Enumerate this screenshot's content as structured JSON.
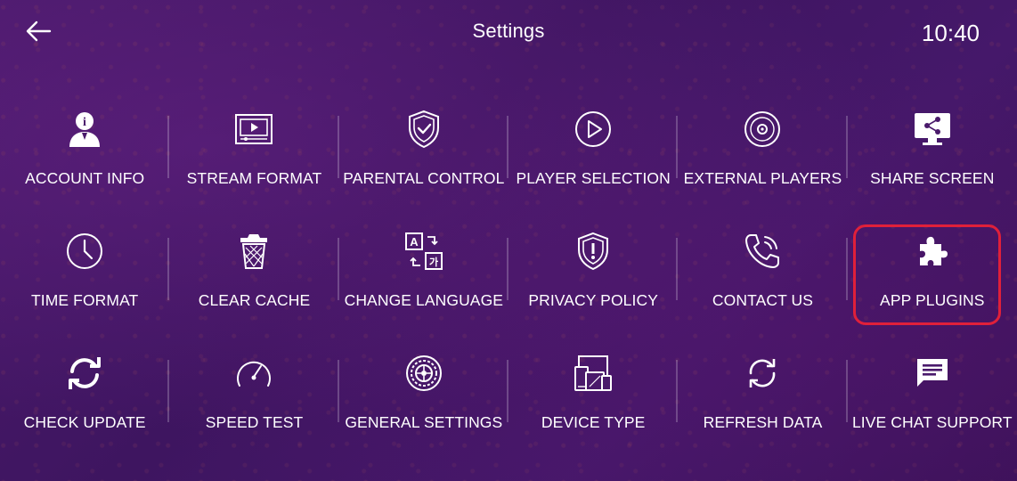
{
  "header": {
    "title": "Settings",
    "time": "10:40"
  },
  "highlight_color": "#e0203a",
  "items": [
    {
      "label": "ACCOUNT INFO",
      "icon": "account-info-icon"
    },
    {
      "label": "STREAM FORMAT",
      "icon": "stream-format-icon"
    },
    {
      "label": "PARENTAL CONTROL",
      "icon": "parental-control-icon"
    },
    {
      "label": "PLAYER SELECTION",
      "icon": "player-selection-icon"
    },
    {
      "label": "EXTERNAL PLAYERS",
      "icon": "external-players-icon"
    },
    {
      "label": "SHARE SCREEN",
      "icon": "share-screen-icon"
    },
    {
      "label": "TIME FORMAT",
      "icon": "clock-icon"
    },
    {
      "label": "CLEAR CACHE",
      "icon": "trash-icon"
    },
    {
      "label": "CHANGE LANGUAGE",
      "icon": "translate-icon"
    },
    {
      "label": "PRIVACY POLICY",
      "icon": "shield-alert-icon"
    },
    {
      "label": "CONTACT US",
      "icon": "phone-icon"
    },
    {
      "label": "APP PLUGINS",
      "icon": "puzzle-icon",
      "selected": true
    },
    {
      "label": "CHECK UPDATE",
      "icon": "sync-icon"
    },
    {
      "label": "SPEED TEST",
      "icon": "speedometer-icon"
    },
    {
      "label": "GENERAL SETTINGS",
      "icon": "settings-wheel-icon"
    },
    {
      "label": "DEVICE TYPE",
      "icon": "devices-icon"
    },
    {
      "label": "REFRESH DATA",
      "icon": "refresh-icon"
    },
    {
      "label": "LIVE CHAT SUPPORT",
      "icon": "chat-icon"
    }
  ]
}
